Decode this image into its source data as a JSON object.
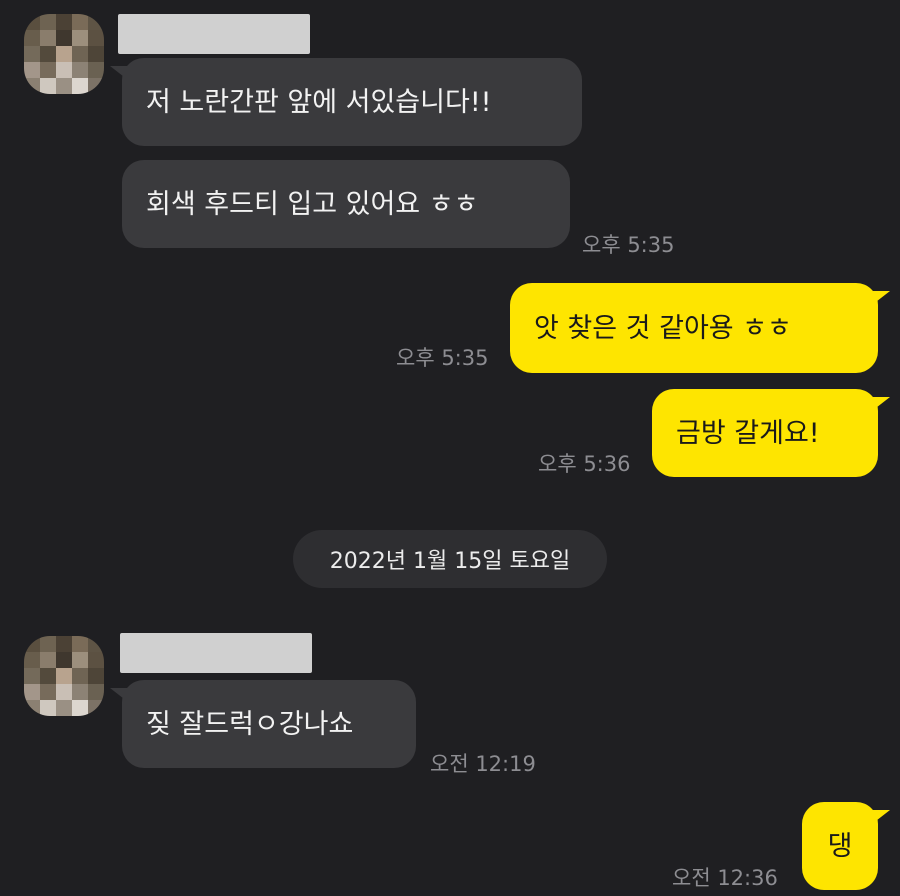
{
  "conversation": {
    "block1": {
      "messages": [
        "저 노란간판 앞에 서있습니다!!",
        "회색 후드티 입고 있어요 ㅎㅎ"
      ],
      "time": "오후 5:35"
    },
    "block2": {
      "messages": [
        "앗 찾은 것 같아용 ㅎㅎ"
      ],
      "time": "오후 5:35"
    },
    "block3": {
      "messages": [
        "금방 갈게요!"
      ],
      "time": "오후 5:36"
    },
    "date_divider": "2022년 1월 15일 토요일",
    "block4": {
      "messages": [
        "짖 잘드럭ㅇ강나쇼"
      ],
      "time": "오전 12:19"
    },
    "block5": {
      "messages": [
        "댕"
      ],
      "time": "오전 12:36"
    }
  },
  "colors": {
    "background": "#1f1f22",
    "incoming_bubble": "#3a3a3d",
    "outgoing_bubble": "#fee500",
    "timestamp": "#8d8d92"
  }
}
